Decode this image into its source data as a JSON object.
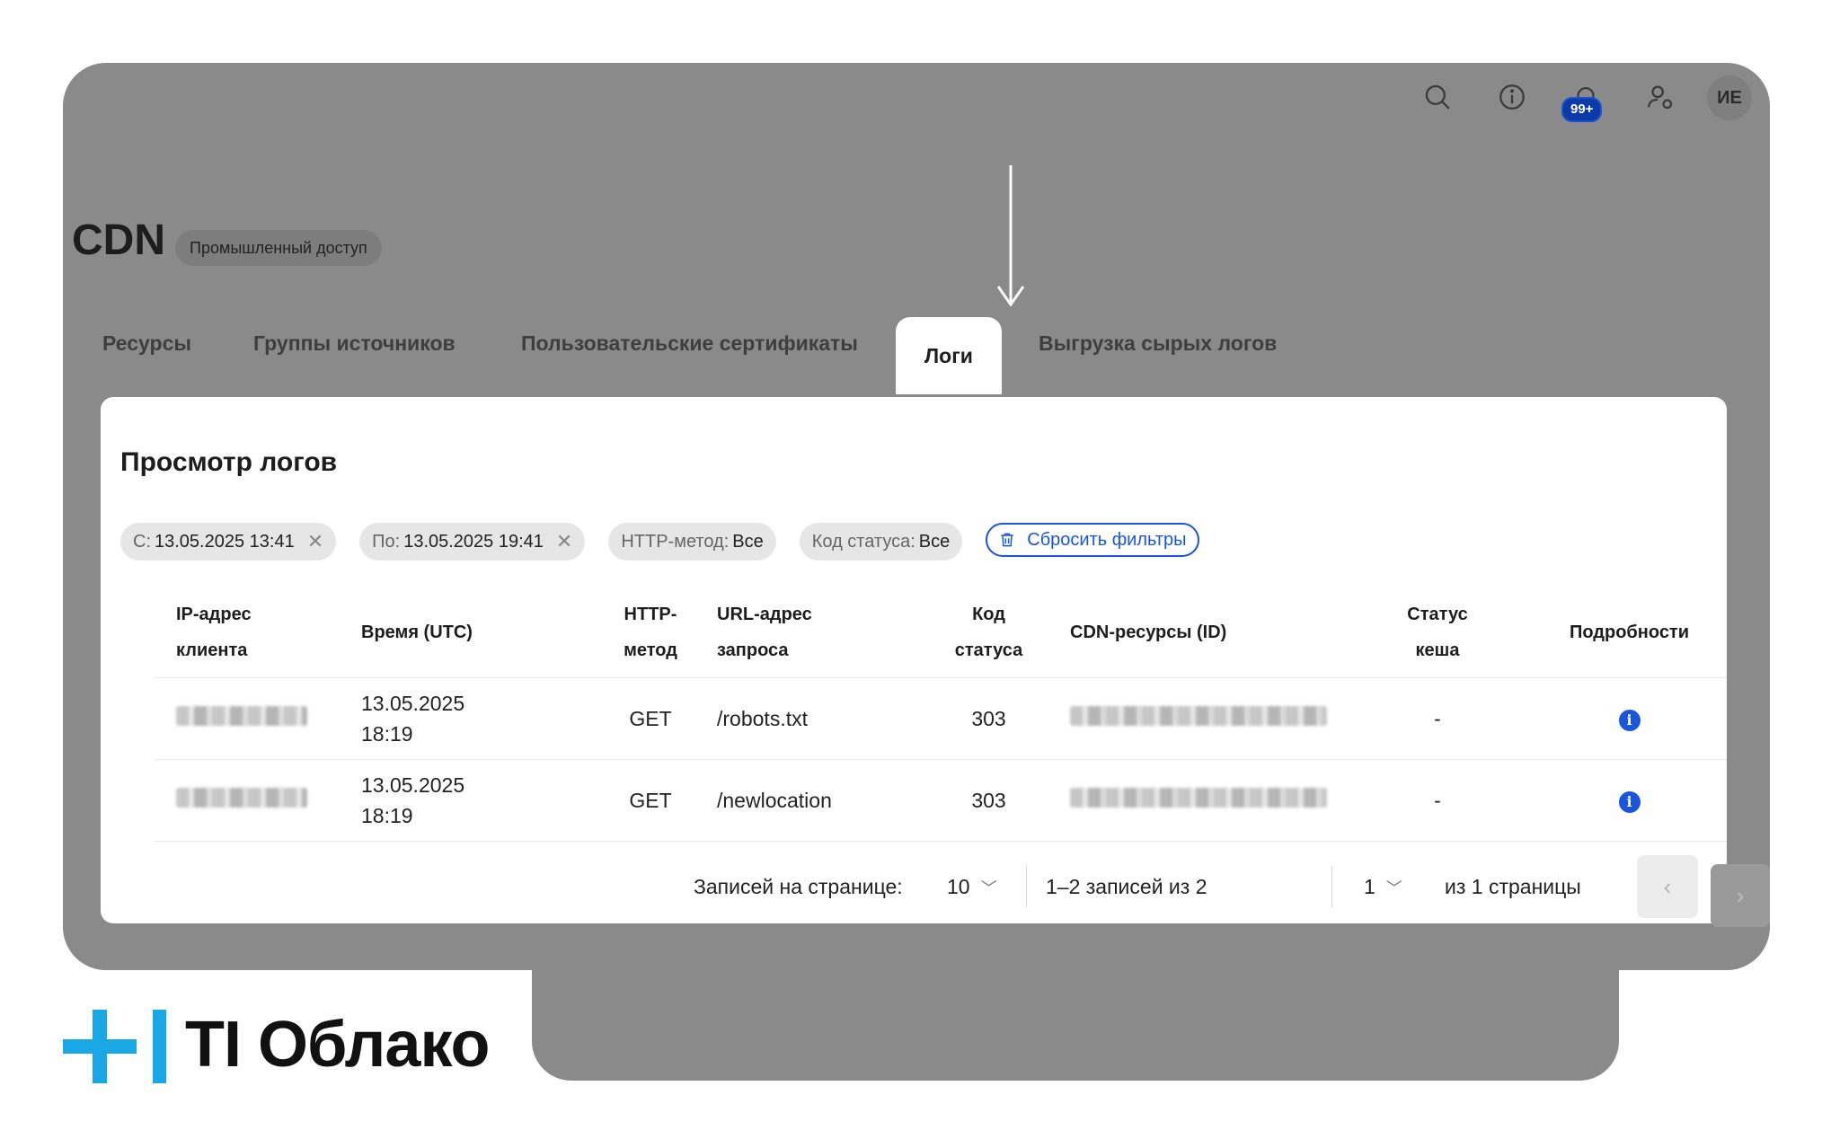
{
  "header": {
    "badge_count": "99+",
    "avatar_initials": "ИЕ",
    "icons": [
      "search-icon",
      "info-icon",
      "bell-icon",
      "user-settings-icon"
    ]
  },
  "service": {
    "title": "CDN",
    "access_label": "Промышленный доступ"
  },
  "tabs": [
    {
      "label": "Ресурсы",
      "active": false
    },
    {
      "label": "Группы источников",
      "active": false
    },
    {
      "label": "Пользовательские сертификаты",
      "active": false
    },
    {
      "label": "Логи",
      "active": true
    },
    {
      "label": "Выгрузка сырых логов",
      "active": false
    }
  ],
  "logs": {
    "title": "Просмотр логов",
    "filters": [
      {
        "key": "С:",
        "value": "13.05.2025 13:41",
        "removable": true
      },
      {
        "key": "По:",
        "value": "13.05.2025 19:41",
        "removable": true
      },
      {
        "key": "HTTP-метод:",
        "value": "Все",
        "removable": false
      },
      {
        "key": "Код статуса:",
        "value": "Все",
        "removable": false
      }
    ],
    "reset_label": "Сбросить фильтры",
    "columns": {
      "ip_l1": "IP-адрес",
      "ip_l2": "клиента",
      "time": "Время (UTC)",
      "method_l1": "HTTP-",
      "method_l2": "метод",
      "url_l1": "URL-адрес",
      "url_l2": "запроса",
      "code_l1": "Код",
      "code_l2": "статуса",
      "cdn": "CDN-ресурсы (ID)",
      "cache_l1": "Статус",
      "cache_l2": "кеша",
      "details": "Подробности"
    },
    "rows": [
      {
        "date": "13.05.2025",
        "time": "18:19",
        "method": "GET",
        "url": "/robots.txt",
        "code": "303",
        "cache": "-"
      },
      {
        "date": "13.05.2025",
        "time": "18:19",
        "method": "GET",
        "url": "/newlocation",
        "code": "303",
        "cache": "-"
      }
    ]
  },
  "pagination": {
    "per_page_label": "Записей на странице:",
    "per_page_value": "10",
    "range_text": "1–2 записей из 2",
    "page_value": "1",
    "pages_text": "из 1 страницы"
  },
  "logo": {
    "text": "TI Облако",
    "colors": {
      "plus": "#1aa7e6",
      "bar": "#1aa7e6"
    }
  }
}
